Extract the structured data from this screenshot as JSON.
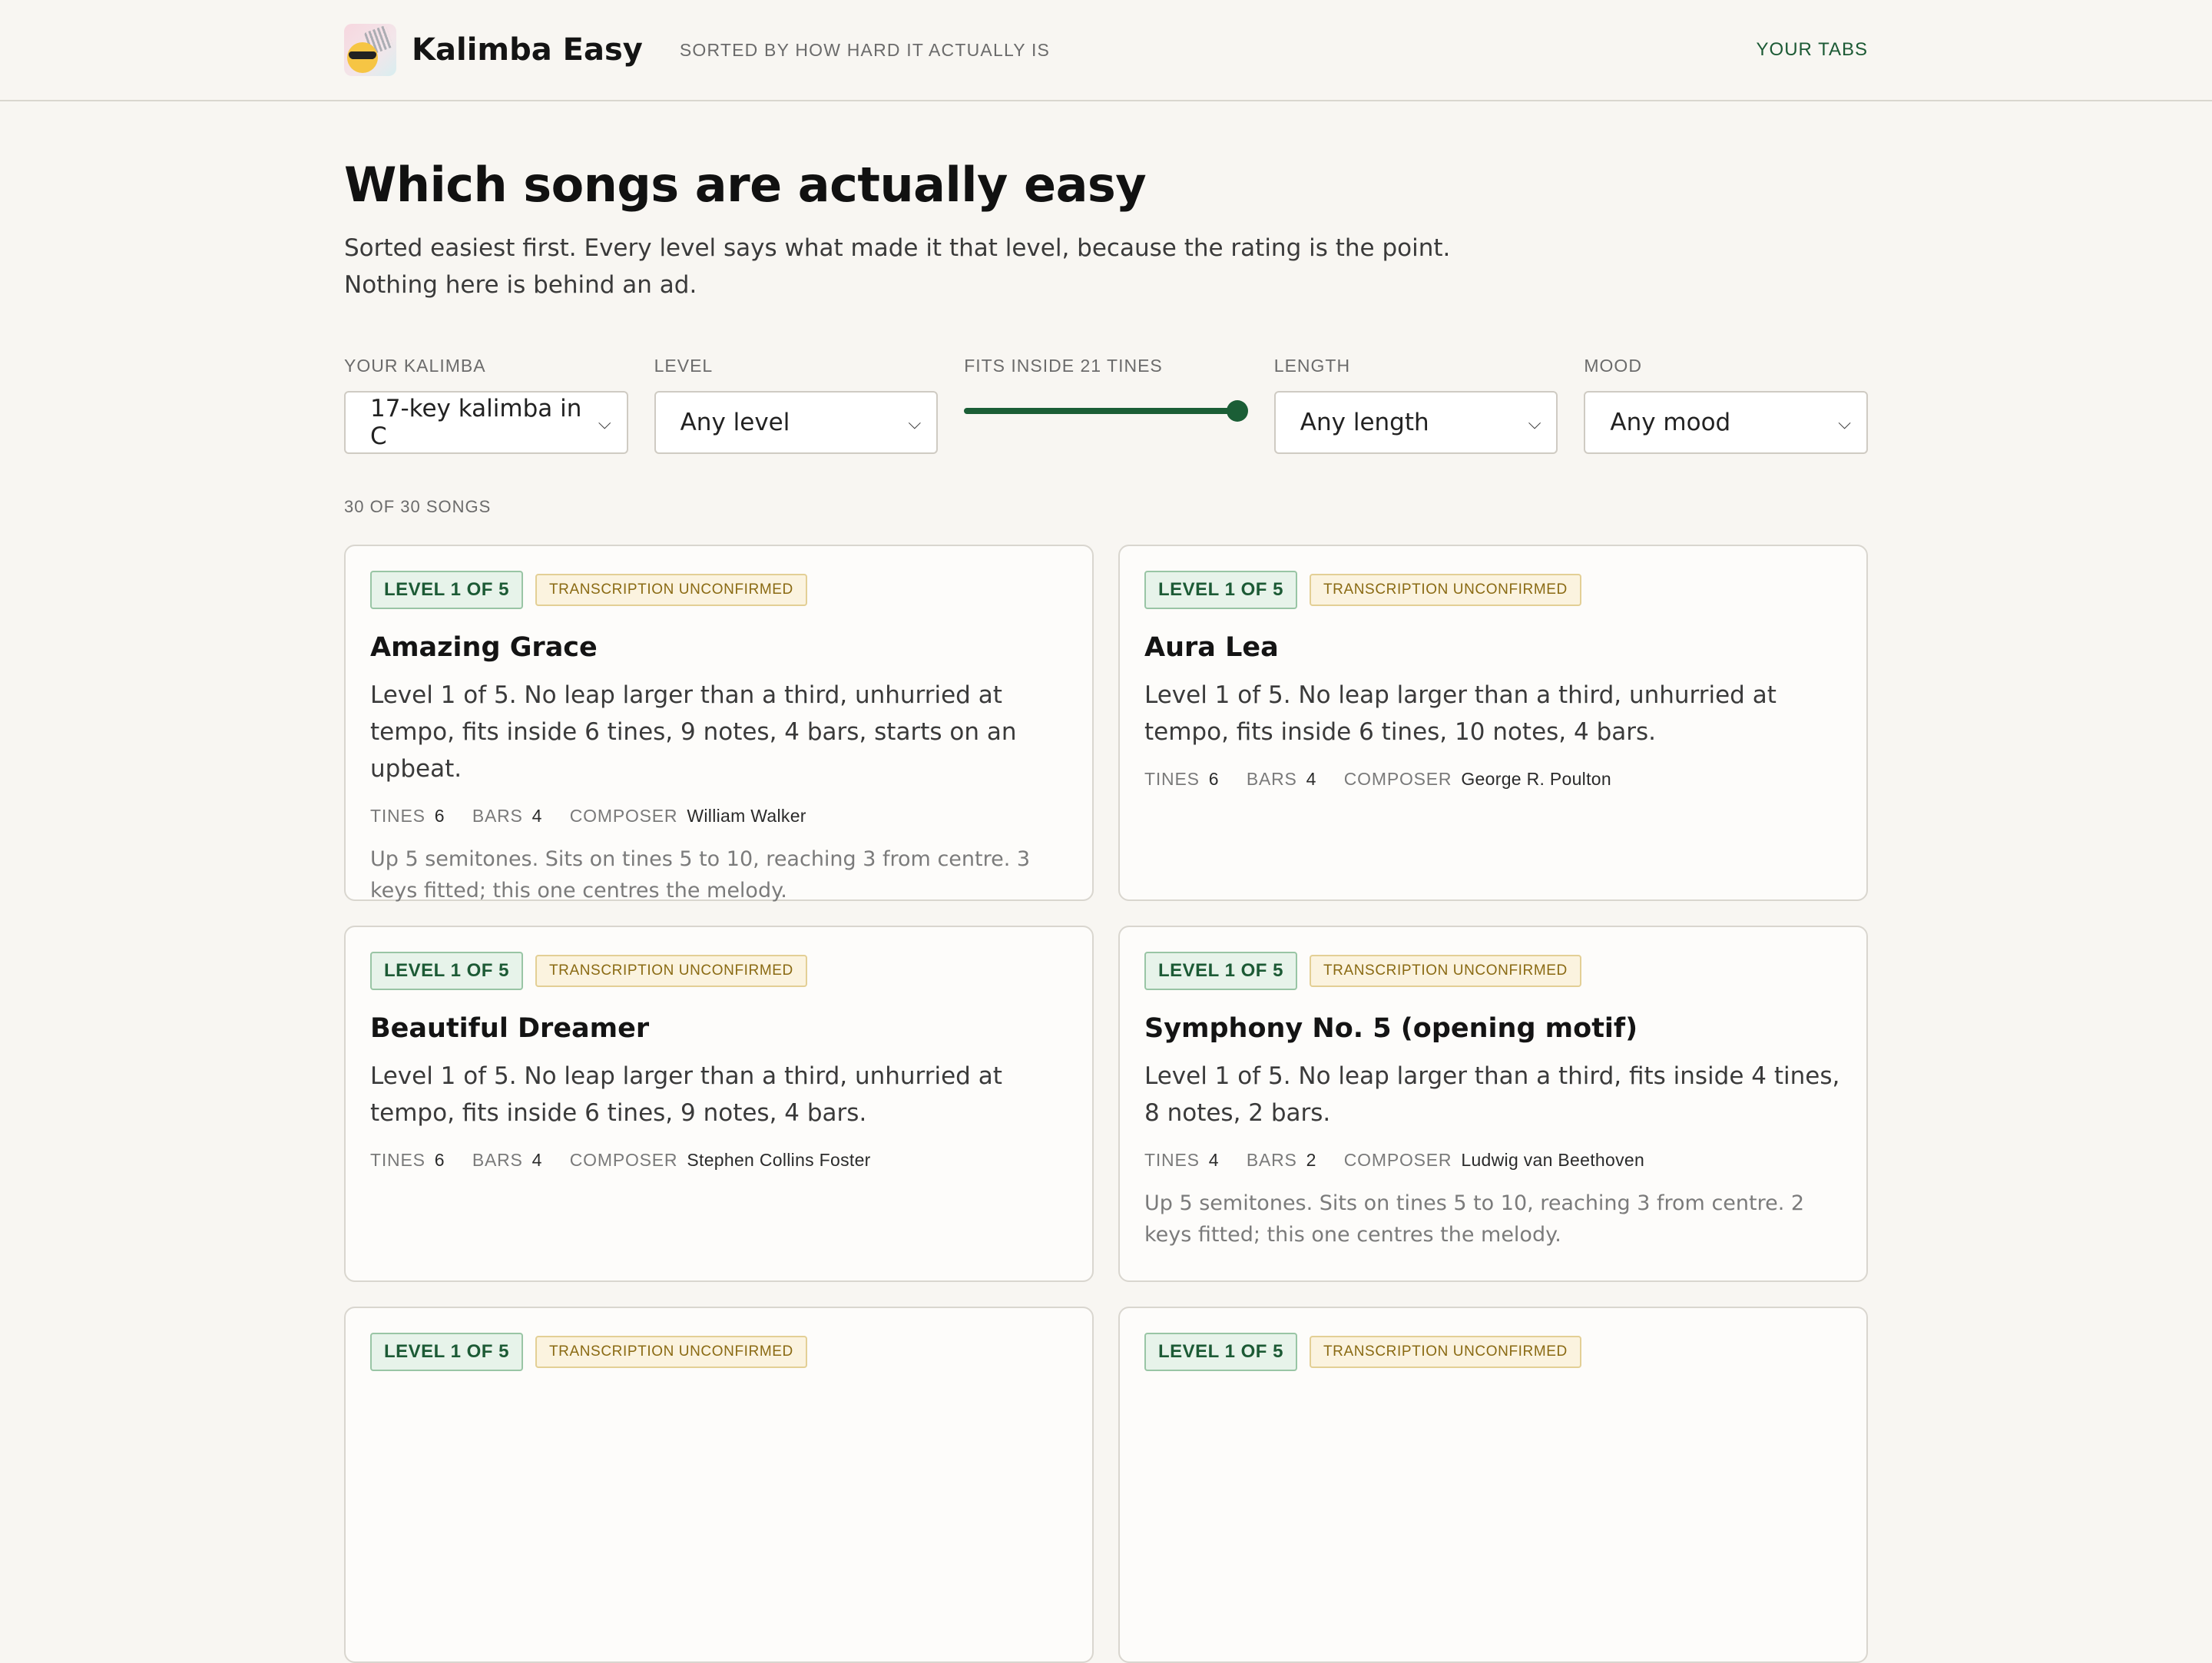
{
  "header": {
    "brand": "Kalimba Easy",
    "tagline": "SORTED BY HOW HARD IT ACTUALLY IS",
    "nav_link": "YOUR TABS"
  },
  "page": {
    "title": "Which songs are actually easy",
    "lede": "Sorted easiest first. Every level says what made it that level, because the rating is the point. Nothing here is behind an ad."
  },
  "filters": {
    "kalimba_label": "YOUR KALIMBA",
    "kalimba_value": "17-key kalimba in C",
    "level_label": "LEVEL",
    "level_value": "Any level",
    "tines_label": "FITS INSIDE 21 TINES",
    "tines_value": 21,
    "length_label": "LENGTH",
    "length_value": "Any length",
    "mood_label": "MOOD",
    "mood_value": "Any mood"
  },
  "count": "30 OF 30 SONGS",
  "labels": {
    "tines": "TINES",
    "bars": "BARS",
    "composer": "COMPOSER"
  },
  "cards": [
    {
      "level": "LEVEL 1 OF 5",
      "status": "TRANSCRIPTION UNCONFIRMED",
      "title": "Amazing Grace",
      "desc": "Level 1 of 5. No leap larger than a third, unhurried at tempo, fits inside 6 tines, 9 notes, 4 bars, starts on an upbeat.",
      "tines": "6",
      "bars": "4",
      "composer": "William Walker",
      "note": "Up 5 semitones. Sits on tines 5 to 10, reaching 3 from centre. 3 keys fitted; this one centres the melody."
    },
    {
      "level": "LEVEL 1 OF 5",
      "status": "TRANSCRIPTION UNCONFIRMED",
      "title": "Aura Lea",
      "desc": "Level 1 of 5. No leap larger than a third, unhurried at tempo, fits inside 6 tines, 10 notes, 4 bars.",
      "tines": "6",
      "bars": "4",
      "composer": "George R. Poulton",
      "note": ""
    },
    {
      "level": "LEVEL 1 OF 5",
      "status": "TRANSCRIPTION UNCONFIRMED",
      "title": "Beautiful Dreamer",
      "desc": "Level 1 of 5. No leap larger than a third, unhurried at tempo, fits inside 6 tines, 9 notes, 4 bars.",
      "tines": "6",
      "bars": "4",
      "composer": "Stephen Collins Foster",
      "note": ""
    },
    {
      "level": "LEVEL 1 OF 5",
      "status": "TRANSCRIPTION UNCONFIRMED",
      "title": "Symphony No. 5 (opening motif)",
      "desc": "Level 1 of 5. No leap larger than a third, fits inside 4 tines, 8 notes, 2 bars.",
      "tines": "4",
      "bars": "2",
      "composer": "Ludwig van Beethoven",
      "note": "Up 5 semitones. Sits on tines 5 to 10, reaching 3 from centre. 2 keys fitted; this one centres the melody."
    },
    {
      "level": "LEVEL 1 OF 5",
      "status": "TRANSCRIPTION UNCONFIRMED"
    },
    {
      "level": "LEVEL 1 OF 5",
      "status": "TRANSCRIPTION UNCONFIRMED"
    }
  ]
}
